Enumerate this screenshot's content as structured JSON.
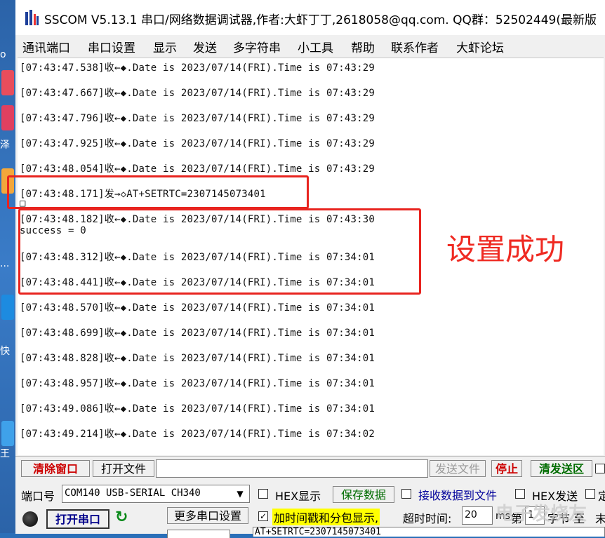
{
  "window": {
    "title": "SSCOM V5.13.1 串口/网络数据调试器,作者:大虾丁丁,2618058@qq.com. QQ群：52502449(最新版"
  },
  "desktop": {
    "glyphs": [
      "o",
      "泽",
      "...",
      "快",
      "王"
    ]
  },
  "menu": [
    "通讯端口",
    "串口设置",
    "显示",
    "发送",
    "多字符串",
    "小工具",
    "帮助",
    "联系作者",
    "大虾论坛"
  ],
  "log_lines": [
    "[07:43:47.538]收←◆.Date is 2023/07/14(FRI).Time is 07:43:29",
    "[07:43:47.667]收←◆.Date is 2023/07/14(FRI).Time is 07:43:29",
    "[07:43:47.796]收←◆.Date is 2023/07/14(FRI).Time is 07:43:29",
    "[07:43:47.925]收←◆.Date is 2023/07/14(FRI).Time is 07:43:29",
    "[07:43:48.054]收←◆.Date is 2023/07/14(FRI).Time is 07:43:29",
    "[07:43:48.171]发→◇AT+SETRTC=2307145073401",
    "□",
    "[07:43:48.182]收←◆.Date is 2023/07/14(FRI).Time is 07:43:30",
    "success = 0",
    "[07:43:48.312]收←◆.Date is 2023/07/14(FRI).Time is 07:34:01",
    "[07:43:48.441]收←◆.Date is 2023/07/14(FRI).Time is 07:34:01",
    "[07:43:48.570]收←◆.Date is 2023/07/14(FRI).Time is 07:34:01",
    "[07:43:48.699]收←◆.Date is 2023/07/14(FRI).Time is 07:34:01",
    "[07:43:48.828]收←◆.Date is 2023/07/14(FRI).Time is 07:34:01",
    "[07:43:48.957]收←◆.Date is 2023/07/14(FRI).Time is 07:34:01",
    "[07:43:49.086]收←◆.Date is 2023/07/14(FRI).Time is 07:34:01",
    "[07:43:49.214]收←◆.Date is 2023/07/14(FRI).Time is 07:34:02"
  ],
  "annotation": "设置成功",
  "toolbar": {
    "clear_window": "清除窗口",
    "open_file": "打开文件",
    "send_file": "发送文件",
    "stop": "停止",
    "clear_send": "清发送区"
  },
  "port": {
    "label": "端口号",
    "value": "COM140 USB-SERIAL CH340",
    "open_button": "打开串口",
    "more_settings": "更多串口设置"
  },
  "options": {
    "hex_display": "HEX显示",
    "save_data": "保存数据",
    "recv_to_file": "接收数据到文件",
    "hex_send": "HEX发送",
    "fixed": "定",
    "timestamp": "加时间戳和分包显示,",
    "timeout_label": "超时时间:",
    "timeout_value": "20",
    "ms": "ms",
    "nth": "第",
    "byte_index": "1",
    "byte_to": "字节 至",
    "end": "末"
  },
  "send_area": "AT+SETRTC=2307145073401",
  "watermark": "电子发烧友"
}
